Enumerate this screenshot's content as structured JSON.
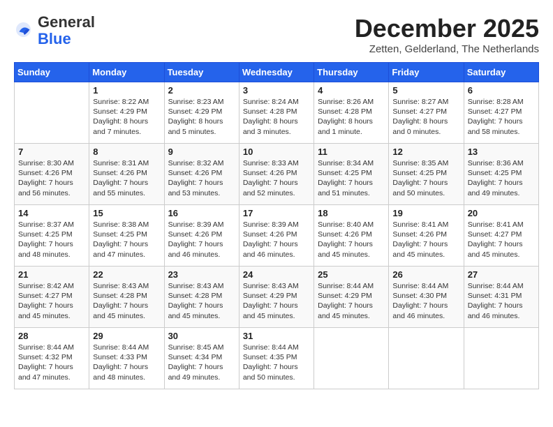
{
  "logo": {
    "general": "General",
    "blue": "Blue"
  },
  "title": "December 2025",
  "subtitle": "Zetten, Gelderland, The Netherlands",
  "days_header": [
    "Sunday",
    "Monday",
    "Tuesday",
    "Wednesday",
    "Thursday",
    "Friday",
    "Saturday"
  ],
  "weeks": [
    [
      {
        "day": "",
        "info": ""
      },
      {
        "day": "1",
        "info": "Sunrise: 8:22 AM\nSunset: 4:29 PM\nDaylight: 8 hours\nand 7 minutes."
      },
      {
        "day": "2",
        "info": "Sunrise: 8:23 AM\nSunset: 4:29 PM\nDaylight: 8 hours\nand 5 minutes."
      },
      {
        "day": "3",
        "info": "Sunrise: 8:24 AM\nSunset: 4:28 PM\nDaylight: 8 hours\nand 3 minutes."
      },
      {
        "day": "4",
        "info": "Sunrise: 8:26 AM\nSunset: 4:28 PM\nDaylight: 8 hours\nand 1 minute."
      },
      {
        "day": "5",
        "info": "Sunrise: 8:27 AM\nSunset: 4:27 PM\nDaylight: 8 hours\nand 0 minutes."
      },
      {
        "day": "6",
        "info": "Sunrise: 8:28 AM\nSunset: 4:27 PM\nDaylight: 7 hours\nand 58 minutes."
      }
    ],
    [
      {
        "day": "7",
        "info": "Sunrise: 8:30 AM\nSunset: 4:26 PM\nDaylight: 7 hours\nand 56 minutes."
      },
      {
        "day": "8",
        "info": "Sunrise: 8:31 AM\nSunset: 4:26 PM\nDaylight: 7 hours\nand 55 minutes."
      },
      {
        "day": "9",
        "info": "Sunrise: 8:32 AM\nSunset: 4:26 PM\nDaylight: 7 hours\nand 53 minutes."
      },
      {
        "day": "10",
        "info": "Sunrise: 8:33 AM\nSunset: 4:26 PM\nDaylight: 7 hours\nand 52 minutes."
      },
      {
        "day": "11",
        "info": "Sunrise: 8:34 AM\nSunset: 4:25 PM\nDaylight: 7 hours\nand 51 minutes."
      },
      {
        "day": "12",
        "info": "Sunrise: 8:35 AM\nSunset: 4:25 PM\nDaylight: 7 hours\nand 50 minutes."
      },
      {
        "day": "13",
        "info": "Sunrise: 8:36 AM\nSunset: 4:25 PM\nDaylight: 7 hours\nand 49 minutes."
      }
    ],
    [
      {
        "day": "14",
        "info": "Sunrise: 8:37 AM\nSunset: 4:25 PM\nDaylight: 7 hours\nand 48 minutes."
      },
      {
        "day": "15",
        "info": "Sunrise: 8:38 AM\nSunset: 4:25 PM\nDaylight: 7 hours\nand 47 minutes."
      },
      {
        "day": "16",
        "info": "Sunrise: 8:39 AM\nSunset: 4:26 PM\nDaylight: 7 hours\nand 46 minutes."
      },
      {
        "day": "17",
        "info": "Sunrise: 8:39 AM\nSunset: 4:26 PM\nDaylight: 7 hours\nand 46 minutes."
      },
      {
        "day": "18",
        "info": "Sunrise: 8:40 AM\nSunset: 4:26 PM\nDaylight: 7 hours\nand 45 minutes."
      },
      {
        "day": "19",
        "info": "Sunrise: 8:41 AM\nSunset: 4:26 PM\nDaylight: 7 hours\nand 45 minutes."
      },
      {
        "day": "20",
        "info": "Sunrise: 8:41 AM\nSunset: 4:27 PM\nDaylight: 7 hours\nand 45 minutes."
      }
    ],
    [
      {
        "day": "21",
        "info": "Sunrise: 8:42 AM\nSunset: 4:27 PM\nDaylight: 7 hours\nand 45 minutes."
      },
      {
        "day": "22",
        "info": "Sunrise: 8:43 AM\nSunset: 4:28 PM\nDaylight: 7 hours\nand 45 minutes."
      },
      {
        "day": "23",
        "info": "Sunrise: 8:43 AM\nSunset: 4:28 PM\nDaylight: 7 hours\nand 45 minutes."
      },
      {
        "day": "24",
        "info": "Sunrise: 8:43 AM\nSunset: 4:29 PM\nDaylight: 7 hours\nand 45 minutes."
      },
      {
        "day": "25",
        "info": "Sunrise: 8:44 AM\nSunset: 4:29 PM\nDaylight: 7 hours\nand 45 minutes."
      },
      {
        "day": "26",
        "info": "Sunrise: 8:44 AM\nSunset: 4:30 PM\nDaylight: 7 hours\nand 46 minutes."
      },
      {
        "day": "27",
        "info": "Sunrise: 8:44 AM\nSunset: 4:31 PM\nDaylight: 7 hours\nand 46 minutes."
      }
    ],
    [
      {
        "day": "28",
        "info": "Sunrise: 8:44 AM\nSunset: 4:32 PM\nDaylight: 7 hours\nand 47 minutes."
      },
      {
        "day": "29",
        "info": "Sunrise: 8:44 AM\nSunset: 4:33 PM\nDaylight: 7 hours\nand 48 minutes."
      },
      {
        "day": "30",
        "info": "Sunrise: 8:45 AM\nSunset: 4:34 PM\nDaylight: 7 hours\nand 49 minutes."
      },
      {
        "day": "31",
        "info": "Sunrise: 8:44 AM\nSunset: 4:35 PM\nDaylight: 7 hours\nand 50 minutes."
      },
      {
        "day": "",
        "info": ""
      },
      {
        "day": "",
        "info": ""
      },
      {
        "day": "",
        "info": ""
      }
    ]
  ]
}
